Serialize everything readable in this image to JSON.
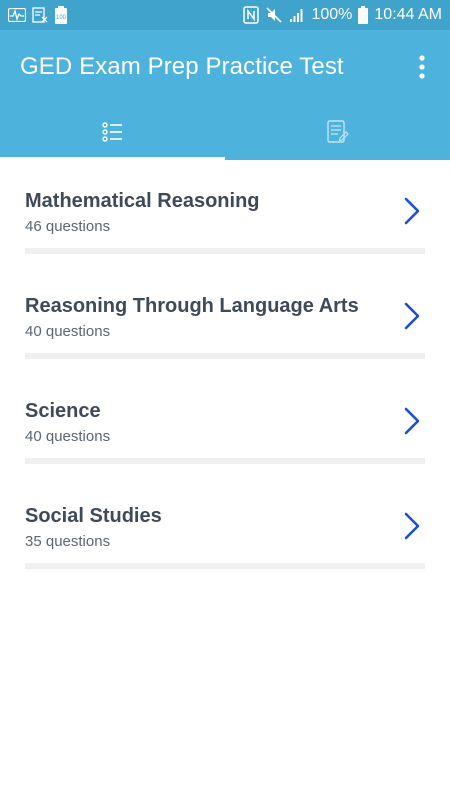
{
  "status_bar": {
    "battery_percent": "100%",
    "time": "10:44 AM"
  },
  "app_bar": {
    "title": "GED Exam Prep Practice Test"
  },
  "tabs": [
    {
      "icon": "list-icon",
      "active": true
    },
    {
      "icon": "document-icon",
      "active": false
    }
  ],
  "subjects": [
    {
      "title": "Mathematical Reasoning",
      "subtitle": "46 questions"
    },
    {
      "title": "Reasoning Through Language Arts",
      "subtitle": "40 questions"
    },
    {
      "title": "Science",
      "subtitle": "40 questions"
    },
    {
      "title": "Social Studies",
      "subtitle": "35 questions"
    }
  ],
  "colors": {
    "app_bar": "#4eb3dc",
    "status_bar": "#3fa3cb",
    "title_text": "#3e4a58",
    "chevron": "#1a4fd0"
  }
}
